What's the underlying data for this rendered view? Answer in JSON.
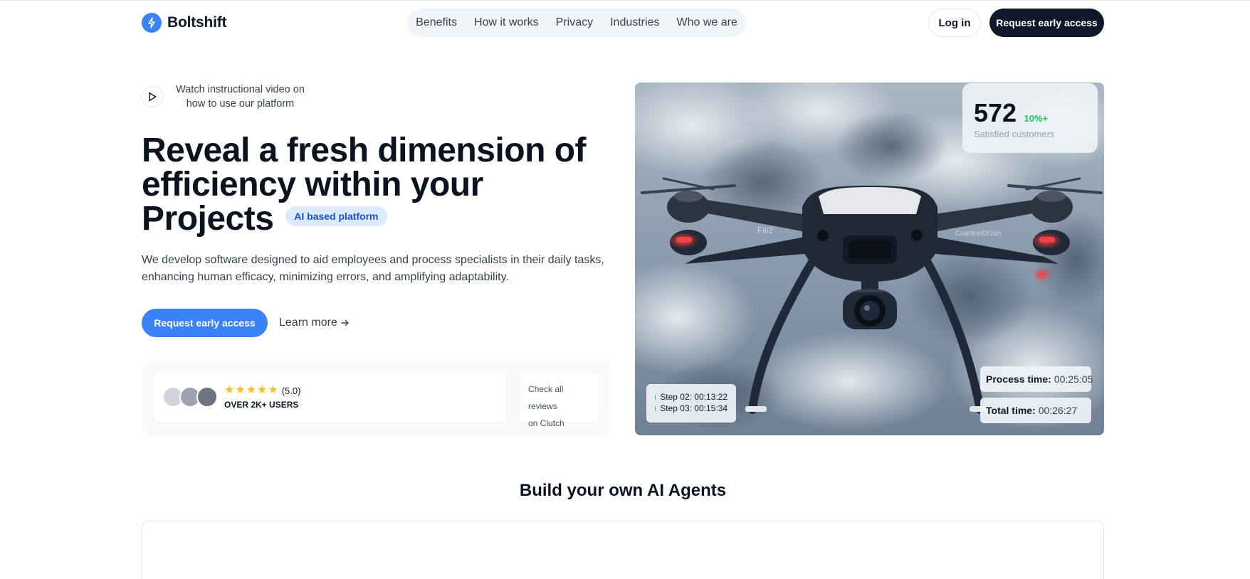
{
  "brand": {
    "name": "Boltshift",
    "accent": "#3b82f6",
    "dark": "#0f172a"
  },
  "nav": {
    "items": [
      {
        "label": "Benefits"
      },
      {
        "label": "How it works"
      },
      {
        "label": "Privacy"
      },
      {
        "label": "Industries"
      },
      {
        "label": "Who we are"
      }
    ],
    "login_label": "Log in",
    "cta_label": "Request early access"
  },
  "hero": {
    "video_text": "Watch instructional video on how to use our platform",
    "headline_line1": "Reveal a fresh dimension of",
    "headline_line2": "efficiency within your",
    "headline_line3": "Projects",
    "badge": "AI based platform",
    "subtext": "We develop software designed to aid employees and process specialists in their daily tasks, enhancing human efficacy, minimizing errors, and amplifying adaptability.",
    "cta_label": "Request early access",
    "learn_more": "Learn more"
  },
  "reviews": {
    "stars": 5,
    "rating": "(5.0)",
    "users": "OVER 2K+ USERS",
    "clutch_line1": "Check all reviews",
    "clutch_line2": "on Clutch"
  },
  "image_overlay": {
    "stat_number": "572",
    "stat_change": "10%+",
    "stat_label": "Satisfied customers",
    "step2": "Step 02: 00:13:22",
    "step3": "Step 03: 00:15:34",
    "process_label": "Process time:",
    "process_value": "00:25:05",
    "total_label": "Total time:",
    "total_value": "00:26:27",
    "drone_text_left": "Fili2",
    "drone_text_right": "CuantonDrzon"
  },
  "section": {
    "title": "Build your own AI Agents"
  }
}
